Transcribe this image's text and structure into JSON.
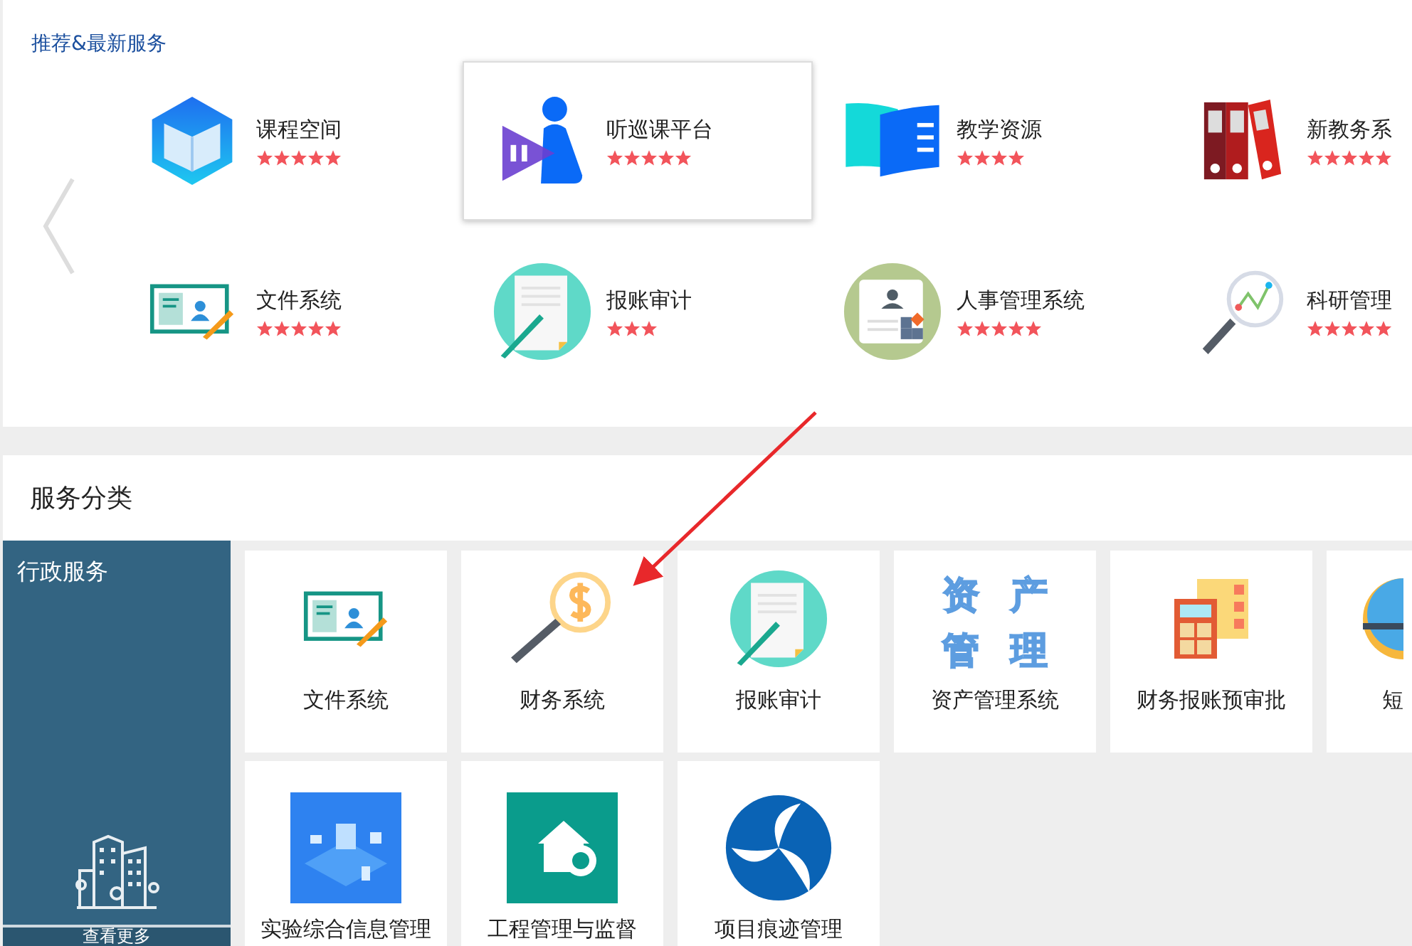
{
  "recommended": {
    "title": "推荐&最新服务",
    "items": [
      {
        "kind": "book-hexagon",
        "name": "课程空间",
        "stars": 5,
        "highlighted": false
      },
      {
        "kind": "video-person",
        "name": "听巡课平台",
        "stars": 5,
        "highlighted": true
      },
      {
        "kind": "open-book",
        "name": "教学资源",
        "stars": 4,
        "highlighted": false
      },
      {
        "kind": "binders",
        "name": "新教务系",
        "stars": 5,
        "highlighted": false
      },
      {
        "kind": "id-card",
        "name": "文件系统",
        "stars": 5,
        "highlighted": false
      },
      {
        "kind": "document-circle",
        "name": "报账审计",
        "stars": 3,
        "highlighted": false
      },
      {
        "kind": "profile-circle",
        "name": "人事管理系统",
        "stars": 5,
        "highlighted": false
      },
      {
        "kind": "chart-magnifier",
        "name": "科研管理",
        "stars": 5,
        "highlighted": false
      }
    ]
  },
  "categories": {
    "title": "服务分类",
    "sidebar": {
      "label": "行政服务",
      "more": "查看更多"
    },
    "tiles": [
      {
        "kind": "id-card",
        "name": "文件系统"
      },
      {
        "kind": "dollar-magnifier",
        "name": "财务系统"
      },
      {
        "kind": "document-circle",
        "name": "报账审计"
      },
      {
        "kind": "asset-text",
        "name": "资产管理系统",
        "icon_text": [
          "资",
          "产",
          "管",
          "理"
        ]
      },
      {
        "kind": "calculator",
        "name": "财务报账预审批"
      },
      {
        "kind": "blue-circle",
        "name": "短"
      },
      {
        "kind": "lab-illustration",
        "name": "实验综合信息管理"
      },
      {
        "kind": "house-gear",
        "name": "工程管理与监督"
      },
      {
        "kind": "swirl-logo",
        "name": "项目痕迹管理"
      }
    ]
  }
}
